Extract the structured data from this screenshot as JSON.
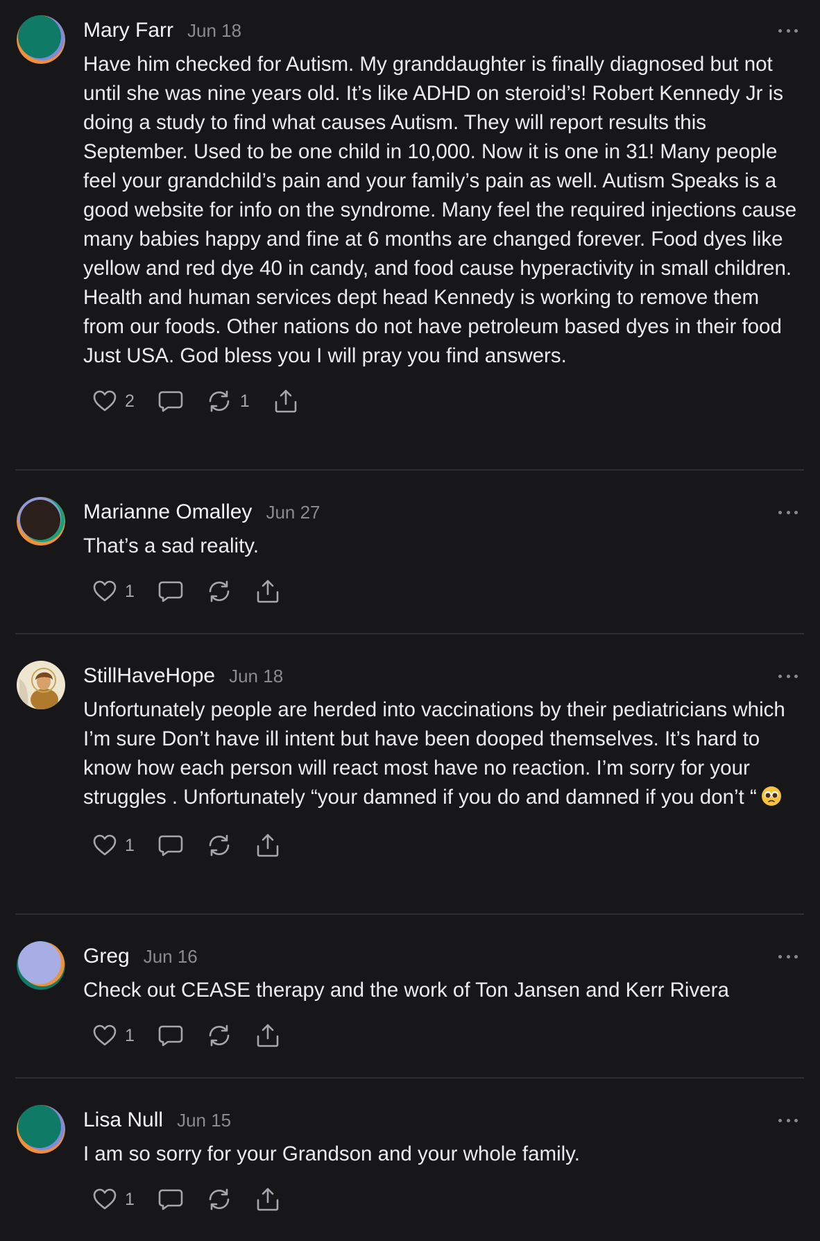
{
  "comments": [
    {
      "author": "Mary Farr",
      "date": "Jun 18",
      "text": "Have him checked for Autism. My granddaughter is finally diagnosed but not until she was nine years old. It’s like ADHD on steroid’s! Robert Kennedy Jr is doing a study to find what causes Autism. They will report results this September. Used to be one child in 10,000. Now it is one in 31! Many people feel your grandchild’s pain and your family’s pain as well. Autism Speaks is a good website for info on the syndrome. Many feel the required injections cause many babies happy and fine at 6 months are changed forever. Food dyes like yellow and red dye 40 in candy, and food cause hyperactivity in small children. Health and human services dept head Kennedy is working to remove them from our foods. Other nations do not have petroleum based dyes in their food Just USA. God bless you I will pray you find answers.",
      "likes": "2",
      "restacks": "1"
    },
    {
      "author": "Marianne Omalley",
      "date": "Jun 27",
      "text": "That’s a sad reality.",
      "likes": "1",
      "restacks": ""
    },
    {
      "author": "StillHaveHope",
      "date": "Jun 18",
      "text": "Unfortunately people are herded into vaccinations by their pediatricians which I’m sure Don’t have ill intent but have been dooped themselves. It’s hard to know how each person will react most have no reaction. I’m sorry for your struggles . Unfortunately “your damned if you do and damned if you don’t “",
      "likes": "1",
      "restacks": ""
    },
    {
      "author": "Greg",
      "date": "Jun 16",
      "text": "Check out CEASE therapy and the work of Ton Jansen and Kerr Rivera",
      "likes": "1",
      "restacks": ""
    },
    {
      "author": "Lisa Null",
      "date": "Jun 15",
      "text": "I am so sorry for your Grandson and your whole family.",
      "likes": "1",
      "restacks": ""
    }
  ],
  "icons": {
    "like": "heart-icon",
    "reply": "comment-bubble-icon",
    "restack": "restack-icon",
    "share": "share-icon",
    "more": "more-dots-icon",
    "emoji": "pleading-face-emoji"
  },
  "colors": {
    "background": "#17171a",
    "text": "#ececef",
    "muted": "#8a8a91",
    "divider": "#2e2e33",
    "avatar_teal": "#0f7a66",
    "avatar_orange": "#f0903a",
    "avatar_lavender": "#a7aee6"
  }
}
